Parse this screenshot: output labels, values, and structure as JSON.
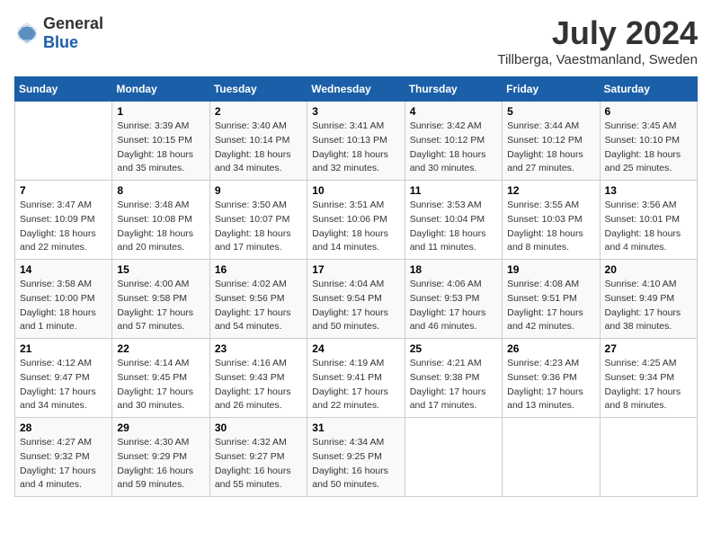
{
  "header": {
    "logo_general": "General",
    "logo_blue": "Blue",
    "title": "July 2024",
    "location": "Tillberga, Vaestmanland, Sweden"
  },
  "days_of_week": [
    "Sunday",
    "Monday",
    "Tuesday",
    "Wednesday",
    "Thursday",
    "Friday",
    "Saturday"
  ],
  "weeks": [
    [
      {
        "day": "",
        "info": ""
      },
      {
        "day": "1",
        "info": "Sunrise: 3:39 AM\nSunset: 10:15 PM\nDaylight: 18 hours\nand 35 minutes."
      },
      {
        "day": "2",
        "info": "Sunrise: 3:40 AM\nSunset: 10:14 PM\nDaylight: 18 hours\nand 34 minutes."
      },
      {
        "day": "3",
        "info": "Sunrise: 3:41 AM\nSunset: 10:13 PM\nDaylight: 18 hours\nand 32 minutes."
      },
      {
        "day": "4",
        "info": "Sunrise: 3:42 AM\nSunset: 10:12 PM\nDaylight: 18 hours\nand 30 minutes."
      },
      {
        "day": "5",
        "info": "Sunrise: 3:44 AM\nSunset: 10:12 PM\nDaylight: 18 hours\nand 27 minutes."
      },
      {
        "day": "6",
        "info": "Sunrise: 3:45 AM\nSunset: 10:10 PM\nDaylight: 18 hours\nand 25 minutes."
      }
    ],
    [
      {
        "day": "7",
        "info": "Sunrise: 3:47 AM\nSunset: 10:09 PM\nDaylight: 18 hours\nand 22 minutes."
      },
      {
        "day": "8",
        "info": "Sunrise: 3:48 AM\nSunset: 10:08 PM\nDaylight: 18 hours\nand 20 minutes."
      },
      {
        "day": "9",
        "info": "Sunrise: 3:50 AM\nSunset: 10:07 PM\nDaylight: 18 hours\nand 17 minutes."
      },
      {
        "day": "10",
        "info": "Sunrise: 3:51 AM\nSunset: 10:06 PM\nDaylight: 18 hours\nand 14 minutes."
      },
      {
        "day": "11",
        "info": "Sunrise: 3:53 AM\nSunset: 10:04 PM\nDaylight: 18 hours\nand 11 minutes."
      },
      {
        "day": "12",
        "info": "Sunrise: 3:55 AM\nSunset: 10:03 PM\nDaylight: 18 hours\nand 8 minutes."
      },
      {
        "day": "13",
        "info": "Sunrise: 3:56 AM\nSunset: 10:01 PM\nDaylight: 18 hours\nand 4 minutes."
      }
    ],
    [
      {
        "day": "14",
        "info": "Sunrise: 3:58 AM\nSunset: 10:00 PM\nDaylight: 18 hours\nand 1 minute."
      },
      {
        "day": "15",
        "info": "Sunrise: 4:00 AM\nSunset: 9:58 PM\nDaylight: 17 hours\nand 57 minutes."
      },
      {
        "day": "16",
        "info": "Sunrise: 4:02 AM\nSunset: 9:56 PM\nDaylight: 17 hours\nand 54 minutes."
      },
      {
        "day": "17",
        "info": "Sunrise: 4:04 AM\nSunset: 9:54 PM\nDaylight: 17 hours\nand 50 minutes."
      },
      {
        "day": "18",
        "info": "Sunrise: 4:06 AM\nSunset: 9:53 PM\nDaylight: 17 hours\nand 46 minutes."
      },
      {
        "day": "19",
        "info": "Sunrise: 4:08 AM\nSunset: 9:51 PM\nDaylight: 17 hours\nand 42 minutes."
      },
      {
        "day": "20",
        "info": "Sunrise: 4:10 AM\nSunset: 9:49 PM\nDaylight: 17 hours\nand 38 minutes."
      }
    ],
    [
      {
        "day": "21",
        "info": "Sunrise: 4:12 AM\nSunset: 9:47 PM\nDaylight: 17 hours\nand 34 minutes."
      },
      {
        "day": "22",
        "info": "Sunrise: 4:14 AM\nSunset: 9:45 PM\nDaylight: 17 hours\nand 30 minutes."
      },
      {
        "day": "23",
        "info": "Sunrise: 4:16 AM\nSunset: 9:43 PM\nDaylight: 17 hours\nand 26 minutes."
      },
      {
        "day": "24",
        "info": "Sunrise: 4:19 AM\nSunset: 9:41 PM\nDaylight: 17 hours\nand 22 minutes."
      },
      {
        "day": "25",
        "info": "Sunrise: 4:21 AM\nSunset: 9:38 PM\nDaylight: 17 hours\nand 17 minutes."
      },
      {
        "day": "26",
        "info": "Sunrise: 4:23 AM\nSunset: 9:36 PM\nDaylight: 17 hours\nand 13 minutes."
      },
      {
        "day": "27",
        "info": "Sunrise: 4:25 AM\nSunset: 9:34 PM\nDaylight: 17 hours\nand 8 minutes."
      }
    ],
    [
      {
        "day": "28",
        "info": "Sunrise: 4:27 AM\nSunset: 9:32 PM\nDaylight: 17 hours\nand 4 minutes."
      },
      {
        "day": "29",
        "info": "Sunrise: 4:30 AM\nSunset: 9:29 PM\nDaylight: 16 hours\nand 59 minutes."
      },
      {
        "day": "30",
        "info": "Sunrise: 4:32 AM\nSunset: 9:27 PM\nDaylight: 16 hours\nand 55 minutes."
      },
      {
        "day": "31",
        "info": "Sunrise: 4:34 AM\nSunset: 9:25 PM\nDaylight: 16 hours\nand 50 minutes."
      },
      {
        "day": "",
        "info": ""
      },
      {
        "day": "",
        "info": ""
      },
      {
        "day": "",
        "info": ""
      }
    ]
  ]
}
